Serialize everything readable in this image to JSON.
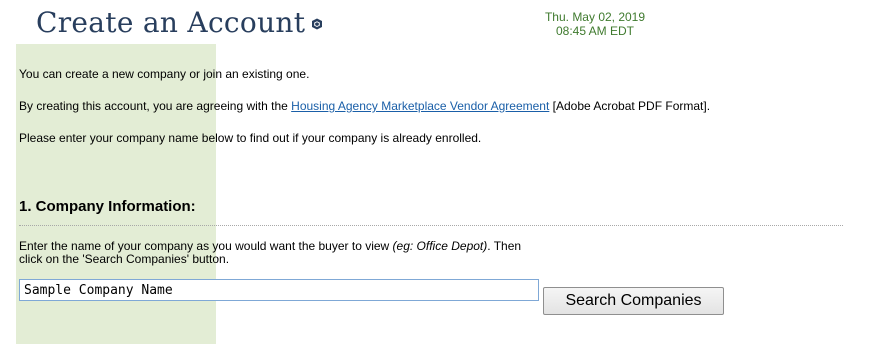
{
  "header": {
    "title": "Create an Account",
    "help_icon": "help-cube-icon",
    "date": "Thu. May 02, 2019",
    "time": "08:45 AM EDT"
  },
  "intro": {
    "line1": "You can create a new company or join an existing one.",
    "line2_prefix": "By creating this account, you are agreeing with the ",
    "line2_link": "Housing Agency Marketplace Vendor Agreement",
    "line2_suffix": " [Adobe Acrobat PDF Format].",
    "line3": "Please enter your company name below to find out if your company is already enrolled."
  },
  "section": {
    "title": "1. Company Information:",
    "instruction_prefix": "Enter the name of your company as you would want the buyer to view ",
    "instruction_example": "(eg: Office Depot)",
    "instruction_suffix": ". Then click on the 'Search Companies' button.",
    "company_name_value": "Sample Company Name",
    "search_button_label": "Search Companies"
  },
  "colors": {
    "title": "#283e5d",
    "datetime": "#3f7a2e",
    "link": "#1a5fa8",
    "side_strip": "#e3edd5",
    "input_border": "#7fa8d6"
  }
}
